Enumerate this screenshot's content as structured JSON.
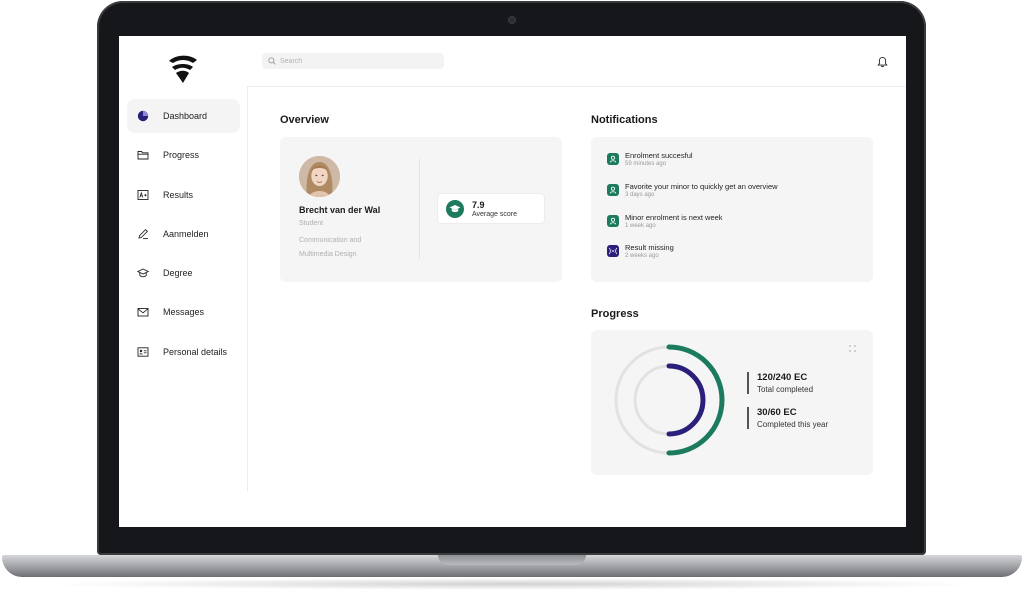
{
  "search": {
    "placeholder": "Search"
  },
  "sidebar": {
    "items": [
      {
        "label": "Dashboard",
        "icon": "pie-chart-icon",
        "active": true
      },
      {
        "label": "Progress",
        "icon": "folder-icon"
      },
      {
        "label": "Results",
        "icon": "grade-icon"
      },
      {
        "label": "Aanmelden",
        "icon": "pencil-icon"
      },
      {
        "label": "Degree",
        "icon": "graduation-cap-icon"
      },
      {
        "label": "Messages",
        "icon": "envelope-icon"
      },
      {
        "label": "Personal details",
        "icon": "id-card-icon"
      }
    ]
  },
  "overview": {
    "title": "Overview",
    "name": "Brecht van der Wal",
    "role": "Student",
    "program": "Communication and Multimedia Design",
    "score_value": "7.9",
    "score_label": "Average score"
  },
  "notifications": {
    "title": "Notifications",
    "items": [
      {
        "title": "Enrolment succesful",
        "time": "59 minutes ago",
        "icon": "user-icon",
        "color": "#1c7a5e"
      },
      {
        "title": "Favorite your minor to quickly get an overview",
        "time": "3 days ago",
        "icon": "user-icon",
        "color": "#1c7a5e"
      },
      {
        "title": "Minor enrolment is next week",
        "time": "1 week ago",
        "icon": "user-icon",
        "color": "#1c7a5e"
      },
      {
        "title": "Result missing",
        "time": "2 weeks ago",
        "icon": "broadcast-icon",
        "color": "#2a1f7a"
      }
    ]
  },
  "progress": {
    "title": "Progress",
    "total": {
      "value": "120/240 EC",
      "label": "Total completed",
      "fraction": 0.5,
      "color": "#1c7a5e"
    },
    "year": {
      "value": "30/60 EC",
      "label": "Completed this year",
      "fraction": 0.5,
      "color": "#2a1f7a"
    }
  },
  "colors": {
    "accent_green": "#1c7a5e",
    "accent_purple": "#2a1f7a"
  }
}
